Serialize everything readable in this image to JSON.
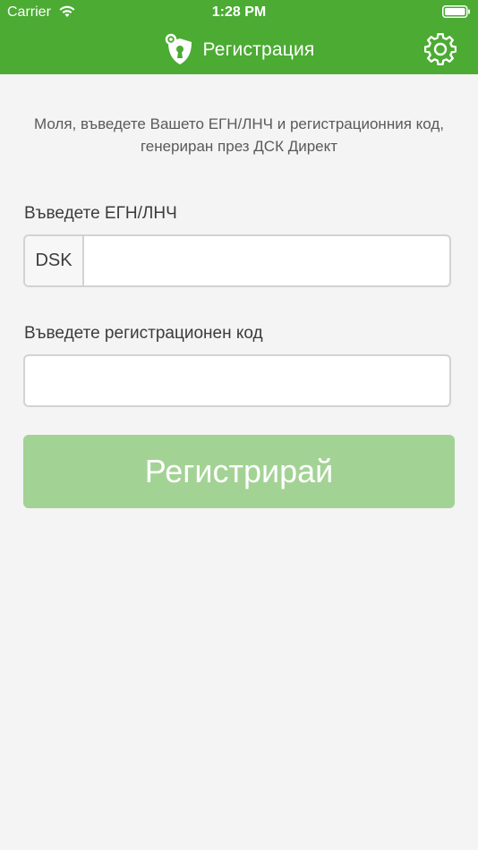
{
  "status_bar": {
    "carrier": "Carrier",
    "time": "1:28 PM"
  },
  "navbar": {
    "title": "Регистрация",
    "logo_icon": "shield-lock-icon",
    "settings_icon": "gear-icon"
  },
  "form": {
    "intro": "Моля, въведете Вашето ЕГН/ЛНЧ и регистрационния код, генериран през ДСК Директ",
    "egn_label": "Въведете ЕГН/ЛНЧ",
    "egn_prefix": "DSK",
    "egn_value": "",
    "code_label": "Въведете регистрационен код",
    "code_value": "",
    "submit_label": "Регистрирай"
  },
  "colors": {
    "brand_green": "#4bab33",
    "button_disabled": "#a3d295",
    "background": "#f4f4f4"
  }
}
